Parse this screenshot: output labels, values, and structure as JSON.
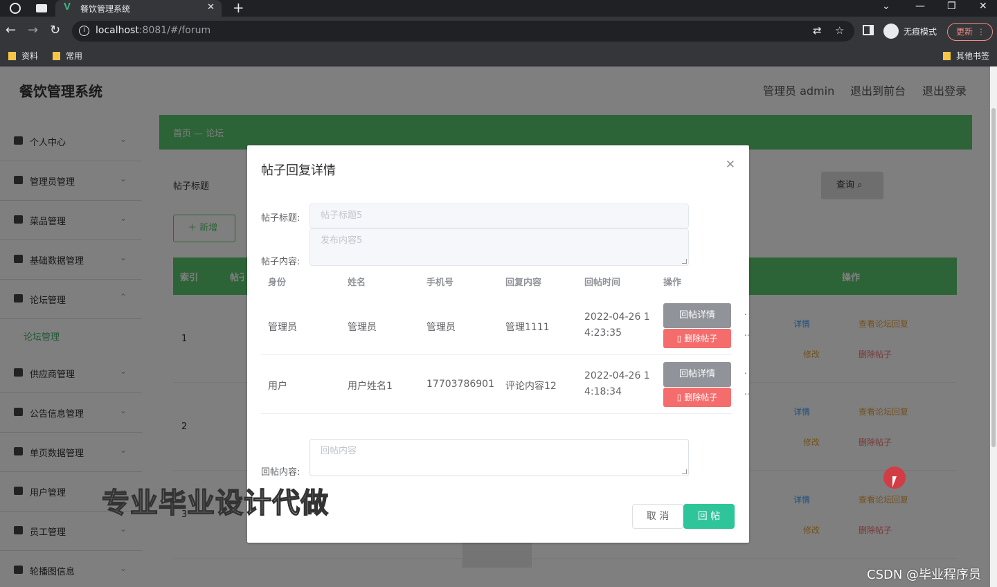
{
  "browser": {
    "tab_title": "餐饮管理系统",
    "url_host": "localhost",
    "url_rest": ":8081/#/forum",
    "incognito_label": "无痕模式",
    "update_label": "更新",
    "bookmarks": [
      "资料",
      "常用"
    ],
    "other_bookmarks": "其他书签"
  },
  "app": {
    "title": "餐饮管理系统",
    "header_links": [
      "管理员 admin",
      "退出到前台",
      "退出登录"
    ]
  },
  "sidebar": {
    "items": [
      {
        "label": "个人中心"
      },
      {
        "label": "管理员管理"
      },
      {
        "label": "菜品管理"
      },
      {
        "label": "基础数据管理"
      },
      {
        "label": "论坛管理"
      },
      {
        "label": "供应商管理"
      },
      {
        "label": "公告信息管理"
      },
      {
        "label": "单页数据管理"
      },
      {
        "label": "用户管理"
      },
      {
        "label": "员工管理"
      },
      {
        "label": "轮播图信息"
      }
    ],
    "active_sub": "论坛管理"
  },
  "page": {
    "crumb": "首页 — 论坛",
    "filter_label": "帖子标题",
    "search_button": "查询",
    "add_button": "新增",
    "columns": [
      "索引",
      "帖子标题",
      "操作"
    ],
    "rows": [
      {
        "index": "1",
        "ops": [
          "详情",
          "查看论坛回复",
          "修改",
          "删除帖子"
        ]
      },
      {
        "index": "2",
        "ops": [
          "详情",
          "查看论坛回复",
          "修改",
          "删除帖子"
        ]
      },
      {
        "index": "3",
        "ops": [
          "详情",
          "查看论坛回复",
          "修改",
          "删除帖子"
        ]
      }
    ]
  },
  "modal": {
    "title": "帖子回复详情",
    "title_label": "帖子标题:",
    "title_placeholder": "帖子标题5",
    "content_label": "帖子内容:",
    "content_placeholder": "发布内容5",
    "columns": [
      "身份",
      "姓名",
      "手机号",
      "回复内容",
      "回帖时间",
      "操作"
    ],
    "replies": [
      {
        "role": "管理员",
        "name": "管理员",
        "phone": "管理员",
        "content": "管理1111",
        "time": "2022-04-26 14:23:35",
        "detail_btn": "回帖详情",
        "delete_btn": "删除帖子"
      },
      {
        "role": "用户",
        "name": "用户姓名1",
        "phone": "17703786901",
        "content": "评论内容12",
        "time": "2022-04-26 14:18:34",
        "detail_btn": "回帖详情",
        "delete_btn": "删除帖子"
      }
    ],
    "reply_label": "回帖内容:",
    "reply_placeholder": "回帖内容",
    "cancel_button": "取 消",
    "reply_button": "回 帖"
  },
  "overlay_text": {
    "watermark": "专业毕业设计代做",
    "csdn": "CSDN @毕业程序员"
  },
  "colors": {
    "accent_green": "#5ac86e",
    "reply_button": "#2fc59b",
    "danger": "#f56c6c",
    "info": "#909399"
  }
}
